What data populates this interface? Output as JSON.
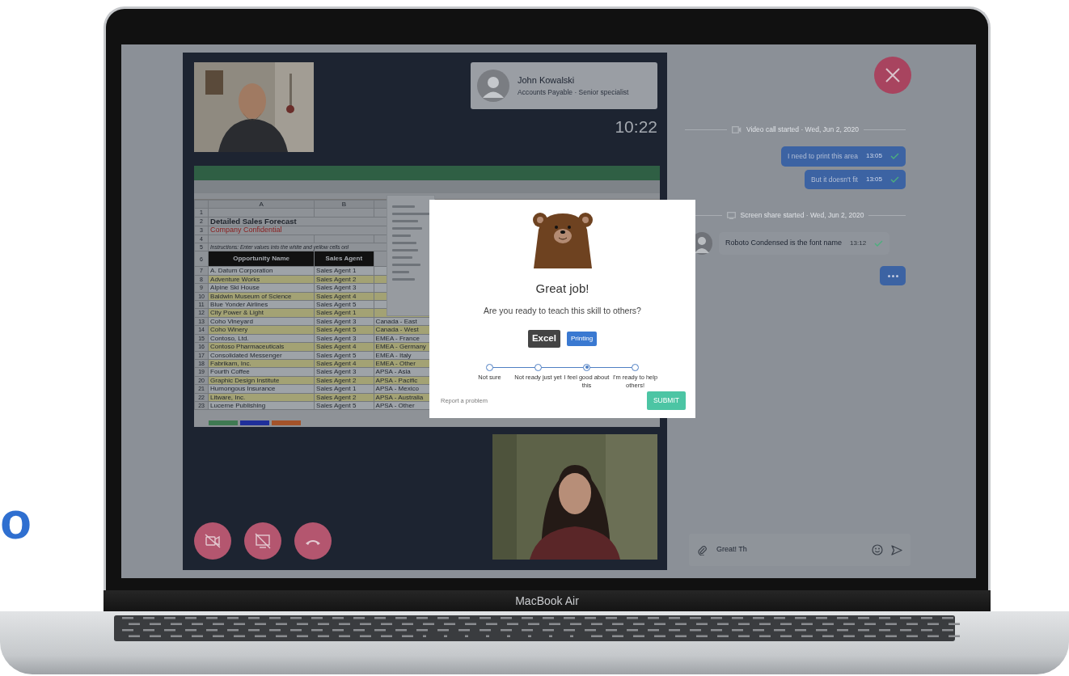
{
  "edge_text": "o",
  "laptop": {
    "brand_label": "MacBook Air"
  },
  "call": {
    "caller": {
      "name": "John Kowalski",
      "role": "Accounts Payable · Senior specialist"
    },
    "clock": "10:22",
    "shared_sheet": {
      "columns": [
        "A",
        "B"
      ],
      "rows": [
        {
          "number": "1",
          "kind": "blank"
        },
        {
          "number": "2",
          "kind": "title",
          "cells": [
            "Detailed Sales Forecast"
          ]
        },
        {
          "number": "3",
          "kind": "subtitle",
          "cells": [
            "Company Confidential"
          ]
        },
        {
          "number": "4",
          "kind": "blank"
        },
        {
          "number": "5",
          "kind": "note",
          "cells": [
            "Instructions: Enter values into the white and yellow cells onl"
          ]
        },
        {
          "number": "6",
          "kind": "header",
          "cells": [
            "Opportunity Name",
            "Sales Agent"
          ]
        },
        {
          "number": "7",
          "kind": "data",
          "highlighted": false,
          "cells": [
            "A. Datum Corporation",
            "Sales Agent 1"
          ]
        },
        {
          "number": "8",
          "kind": "data",
          "highlighted": true,
          "cells": [
            "Adventure Works",
            "Sales Agent 2"
          ]
        },
        {
          "number": "9",
          "kind": "data",
          "highlighted": false,
          "cells": [
            "Alpine Ski House",
            "Sales Agent 3"
          ]
        },
        {
          "number": "10",
          "kind": "data",
          "highlighted": true,
          "cells": [
            "Baldwin Museum of Science",
            "Sales Agent 4"
          ]
        },
        {
          "number": "11",
          "kind": "data",
          "highlighted": false,
          "cells": [
            "Blue Yonder Airlines",
            "Sales Agent 5"
          ]
        },
        {
          "number": "12",
          "kind": "data",
          "highlighted": true,
          "cells": [
            "City Power & Light",
            "Sales Agent 1"
          ]
        },
        {
          "number": "13",
          "kind": "data",
          "highlighted": false,
          "cells": [
            "Coho Vineyard",
            "Sales Agent 3",
            "Canada - East"
          ]
        },
        {
          "number": "14",
          "kind": "data",
          "highlighted": true,
          "cells": [
            "Coho Winery",
            "Sales Agent 5",
            "Canada - West"
          ]
        },
        {
          "number": "15",
          "kind": "data",
          "highlighted": false,
          "cells": [
            "Contoso, Ltd.",
            "Sales Agent 3",
            "EMEA - France"
          ]
        },
        {
          "number": "16",
          "kind": "data",
          "highlighted": true,
          "cells": [
            "Contoso Pharmaceuticals",
            "Sales Agent 4",
            "EMEA - Germany"
          ]
        },
        {
          "number": "17",
          "kind": "data",
          "highlighted": false,
          "cells": [
            "Consolidated Messenger",
            "Sales Agent 5",
            "EMEA - Italy"
          ]
        },
        {
          "number": "18",
          "kind": "data",
          "highlighted": true,
          "cells": [
            "Fabrikam, Inc.",
            "Sales Agent 4",
            "EMEA - Other"
          ]
        },
        {
          "number": "19",
          "kind": "data",
          "highlighted": false,
          "cells": [
            "Fourth Coffee",
            "Sales Agent 3",
            "APSA - Asia"
          ]
        },
        {
          "number": "20",
          "kind": "data",
          "highlighted": true,
          "cells": [
            "Graphic Design Institute",
            "Sales Agent 2",
            "APSA - Pacific"
          ]
        },
        {
          "number": "21",
          "kind": "data",
          "highlighted": false,
          "cells": [
            "Humongous Insurance",
            "Sales Agent 1",
            "APSA - Mexico"
          ]
        },
        {
          "number": "22",
          "kind": "data",
          "highlighted": true,
          "cells": [
            "Litware, Inc.",
            "Sales Agent 2",
            "APSA - Australia"
          ]
        },
        {
          "number": "23",
          "kind": "data",
          "highlighted": false,
          "cells": [
            "Lucerne Publishing",
            "Sales Agent 5",
            "APSA - Other"
          ]
        }
      ],
      "sheet_tabs": [
        {
          "color": "#3f7a52"
        },
        {
          "color": "#1f2f9a"
        },
        {
          "color": "#a4532a"
        }
      ]
    },
    "controls": [
      {
        "kind": "camera-off"
      },
      {
        "kind": "screen-off"
      },
      {
        "kind": "hang-up"
      }
    ]
  },
  "modal": {
    "title": "Great job!",
    "question": "Are you ready to teach this skill to others?",
    "tags": [
      {
        "label": "Excel",
        "kind": "skill"
      },
      {
        "label": "Printing",
        "kind": "topic"
      }
    ],
    "scale": [
      {
        "label": "Not sure",
        "selected": false
      },
      {
        "label": "Not ready just yet",
        "selected": false
      },
      {
        "label": "I feel good about this",
        "selected": true
      },
      {
        "label": "I'm ready to help others!",
        "selected": false
      }
    ],
    "report_link": "Report a problem",
    "submit": "SUBMIT"
  },
  "chat": {
    "messages": [
      {
        "kind": "call-divider",
        "text": "Video call started · Wed, Jun 2, 2020"
      },
      {
        "kind": "outgoing",
        "text": "I need to print this area",
        "time": "13:05",
        "read": true
      },
      {
        "kind": "outgoing",
        "text": "But it doesn't fit",
        "time": "13:05",
        "read": true
      },
      {
        "kind": "share-divider",
        "text": "Screen share started · Wed, Jun 2, 2020"
      },
      {
        "kind": "incoming",
        "text": "Roboto Condensed is the font name",
        "time": "13:12",
        "read": true
      },
      {
        "kind": "typing"
      }
    ],
    "composer": {
      "value": "Great! Th"
    }
  }
}
